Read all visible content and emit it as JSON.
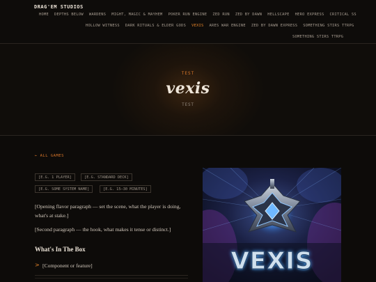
{
  "brand": "DRAG'EM STUDIOS",
  "nav": {
    "row1": [
      "HOME",
      "DEPTHS BELOW",
      "WARDENS",
      "MIGHT, MAGIC & MAYHEM",
      "POKER RUN ENGINE",
      "ZED RUN",
      "ZED BY DAWN",
      "HELLSCAPE",
      "HERO EXPRESS",
      "CRITICAL SS"
    ],
    "row2": [
      "HOLLOW WITNESS",
      "DARK RITUALS & ELDER GODS",
      "VEXIS",
      "ARES WAR ENGINE",
      "ZED BY DAWN EXPRESS",
      "SOMETHING STIRS TTRPG"
    ],
    "row3": [
      "SOMETHING STIRS TTRPG"
    ],
    "active": "VEXIS"
  },
  "hero": {
    "eyebrow": "TEST",
    "title": "vexis",
    "subtitle": "TEST"
  },
  "back_link": "← ALL GAMES",
  "tags": [
    "[E.G. 1 PLAYER]",
    "[E.G. STANDARD DECK]",
    "[E.G. SOME SYSTEM NAME]",
    "[E.G. 15–30 MINUTES]"
  ],
  "paragraphs": [
    "[Opening flavor paragraph — set the scene, what the player is doing, what's at stake.]",
    "[Second paragraph — the hook, what makes it tense or distinct.]"
  ],
  "box": {
    "heading": "What's In The Box",
    "items": [
      "[Component or feature]"
    ],
    "bullet": ">"
  },
  "cover": {
    "title": "VEXIS",
    "alt_icon": "vexis-emblem-icon"
  },
  "colors": {
    "accent": "#e8862a",
    "background": "#0d0b09",
    "text": "#d8cfc4"
  }
}
